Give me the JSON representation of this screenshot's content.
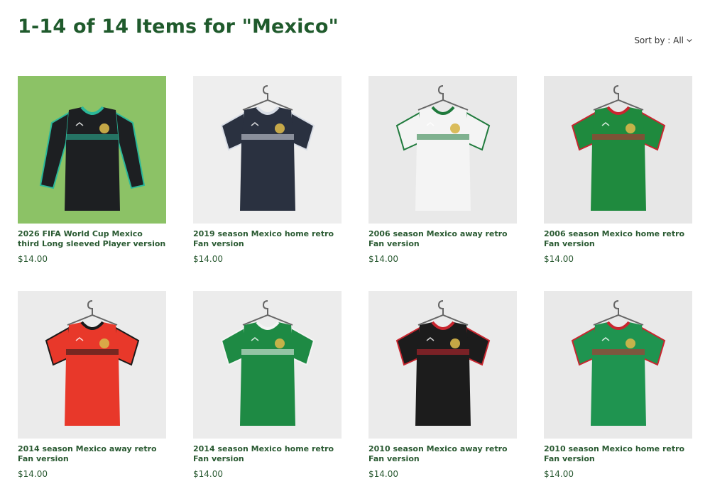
{
  "page": {
    "title": "1-14 of 14 Items for \"Mexico\"",
    "sort_label": "Sort by : All",
    "sort_icon": "chevron-down-icon"
  },
  "products": [
    {
      "name": "2026 FIFA World Cup Mexico third Long sleeved Player version",
      "price": "$14.00",
      "bg": "#8cc266",
      "shirt": "#1d1f22",
      "trim": "#2bb89a",
      "long_sleeve": true,
      "hanger": false
    },
    {
      "name": "2019 season Mexico home retro Fan version",
      "price": "$14.00",
      "bg": "#eeeeee",
      "shirt": "#2a3140",
      "trim": "#d8dde6",
      "long_sleeve": false,
      "hanger": true
    },
    {
      "name": "2006 season Mexico away retro Fan version",
      "price": "$14.00",
      "bg": "#e9e9e9",
      "shirt": "#f4f4f4",
      "trim": "#1f7a3c",
      "long_sleeve": false,
      "hanger": true
    },
    {
      "name": "2006 season Mexico home retro Fan version",
      "price": "$14.00",
      "bg": "#e7e7e7",
      "shirt": "#1f8a3e",
      "trim": "#c8262f",
      "long_sleeve": false,
      "hanger": true
    },
    {
      "name": "2014 season Mexico away retro Fan version",
      "price": "$14.00",
      "bg": "#ebebeb",
      "shirt": "#e8382a",
      "trim": "#1a1a1a",
      "long_sleeve": false,
      "hanger": true
    },
    {
      "name": "2014 season Mexico home retro Fan version",
      "price": "$14.00",
      "bg": "#ececec",
      "shirt": "#1e8a44",
      "trim": "#f4f4f4",
      "long_sleeve": false,
      "hanger": true
    },
    {
      "name": "2010 season Mexico away retro Fan version",
      "price": "$14.00",
      "bg": "#ebebeb",
      "shirt": "#1c1c1c",
      "trim": "#c8262f",
      "long_sleeve": false,
      "hanger": true
    },
    {
      "name": "2010 season Mexico home retro Fan version",
      "price": "$14.00",
      "bg": "#e9e9e9",
      "shirt": "#1f9450",
      "trim": "#c8262f",
      "long_sleeve": false,
      "hanger": true
    }
  ]
}
